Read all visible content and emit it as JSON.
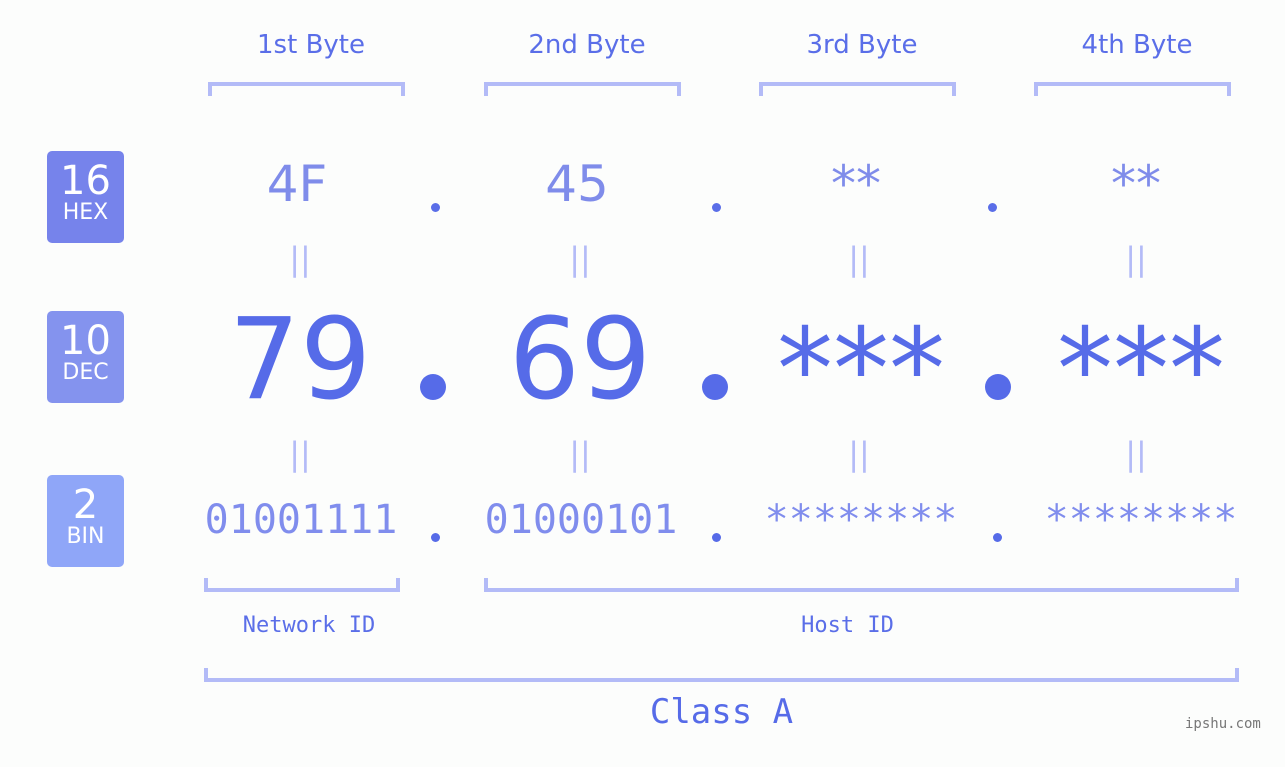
{
  "byte_headers": [
    "1st Byte",
    "2nd Byte",
    "3rd Byte",
    "4th Byte"
  ],
  "bases": [
    {
      "num": "16",
      "label": "HEX",
      "color": "#7683eb"
    },
    {
      "num": "10",
      "label": "DEC",
      "color": "#8493ee"
    },
    {
      "num": "2",
      "label": "BIN",
      "color": "#8fa6f8"
    }
  ],
  "hex": [
    "4F",
    "45",
    "**",
    "**"
  ],
  "dec": [
    "79",
    "69",
    "***",
    "***"
  ],
  "bin": [
    "01001111",
    "01000101",
    "********",
    "********"
  ],
  "equals_symbol": "||",
  "network_id_label": "Network ID",
  "host_id_label": "Host ID",
  "class_label": "Class A",
  "watermark": "ipshu.com",
  "colors": {
    "accent": "#566be8",
    "bracket": "#b3bbf7",
    "hex_text": "#7f8cea",
    "bin_text": "#808ded",
    "background": "#fcfdfc"
  }
}
